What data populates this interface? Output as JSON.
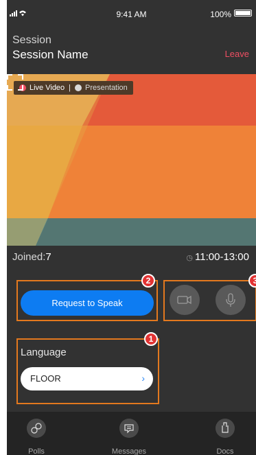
{
  "status_bar": {
    "time": "9:41 AM",
    "battery": "100%"
  },
  "header": {
    "label": "Session",
    "name": "Session Name",
    "leave_label": "Leave"
  },
  "video": {
    "live_label": "Live Video",
    "presentation_label": "Presentation",
    "separator": "|"
  },
  "info": {
    "joined_label": "Joined:",
    "joined_count": "7",
    "time_range": "11:00-13:00"
  },
  "actions": {
    "request_label": "Request to Speak"
  },
  "language": {
    "label": "Language",
    "value": "FLOOR"
  },
  "annotations": {
    "one": "1",
    "two": "2",
    "three": "3"
  },
  "tabs": [
    {
      "label": "Polls",
      "icon": "polls-icon"
    },
    {
      "label": "Messages",
      "icon": "messages-icon"
    },
    {
      "label": "Docs",
      "icon": "docs-icon"
    }
  ],
  "colors": {
    "accent": "#0d7cf2",
    "leave": "#ef4f63",
    "highlight": "#e4791e",
    "badge": "#e23333"
  }
}
